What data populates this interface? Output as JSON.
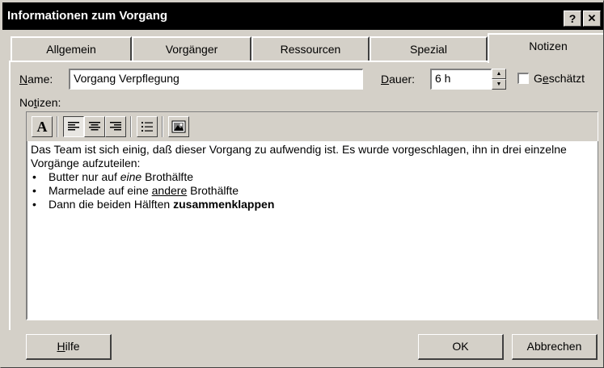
{
  "window": {
    "title": "Informationen zum Vorgang",
    "help_glyph": "?",
    "close_glyph": "✕"
  },
  "tabs": [
    {
      "label": "Allgemein"
    },
    {
      "label": "Vorgänger"
    },
    {
      "label": "Ressourcen"
    },
    {
      "label": "Spezial"
    },
    {
      "label": "Notizen",
      "active": true
    }
  ],
  "name_field": {
    "label_key": "N",
    "label_rest": "ame:",
    "value": "Vorgang Verpflegung"
  },
  "duration_field": {
    "label_key": "D",
    "label_rest": "auer:",
    "value": "6 h"
  },
  "estimated_checkbox": {
    "label_pre": "G",
    "label_key": "e",
    "label_rest": "schätzt",
    "checked": false
  },
  "notes_label": {
    "pre": "No",
    "key": "t",
    "rest": "izen:"
  },
  "toolbar": {
    "font_glyph": "A",
    "icons": [
      "font-icon",
      "align-left-icon",
      "align-center-icon",
      "align-right-icon",
      "bullet-list-icon",
      "insert-object-icon"
    ],
    "pressed": "align-left-icon"
  },
  "notes": {
    "paragraph": "Das Team ist sich einig, daß dieser Vorgang zu aufwendig ist. Es wurde vorgeschlagen, ihn in drei einzelne Vorgänge aufzuteilen:",
    "bullets": [
      {
        "pre": "Butter nur auf ",
        "emph": "eine",
        "post": " Brothälfte"
      },
      {
        "pre": "Marmelade auf eine ",
        "underline": "andere",
        "post": " Brothälfte"
      },
      {
        "pre": "Dann die beiden Hälften ",
        "bold": "zusammenklappen",
        "post": ""
      }
    ]
  },
  "buttons": {
    "help_key": "H",
    "help_rest": "ilfe",
    "ok": "OK",
    "cancel": "Abbrechen"
  }
}
